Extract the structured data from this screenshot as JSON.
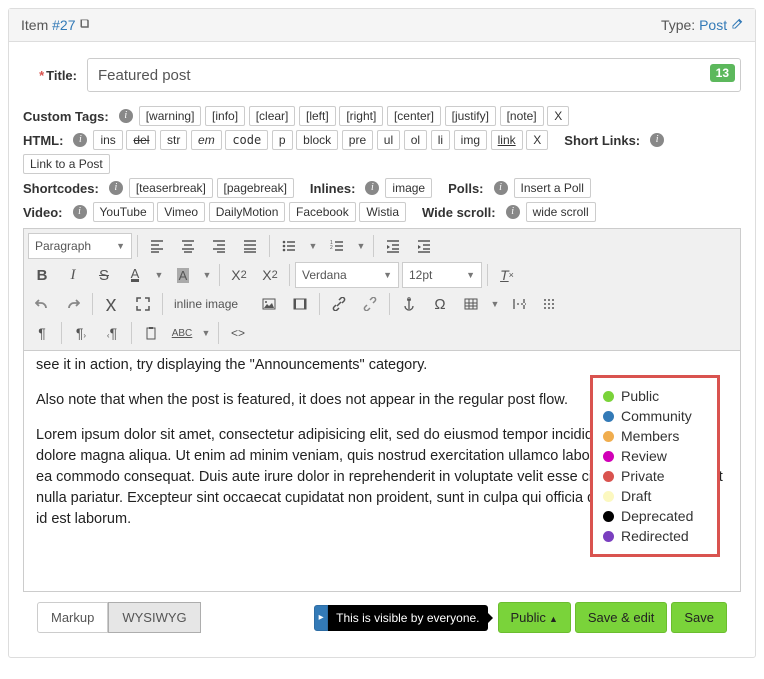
{
  "header": {
    "item_label": "Item",
    "item_link": "#27",
    "type_label": "Type:",
    "type_value": "Post"
  },
  "title": {
    "label": "Title:",
    "value": "Featured post",
    "badge": "13"
  },
  "toolrows": {
    "custom_tags_label": "Custom Tags:",
    "custom_tags": [
      "[warning]",
      "[info]",
      "[clear]",
      "[left]",
      "[right]",
      "[center]",
      "[justify]",
      "[note]",
      "X"
    ],
    "html_label": "HTML:",
    "html_btns": [
      "ins",
      "del",
      "str",
      "em",
      "code",
      "p",
      "block",
      "pre",
      "ul",
      "ol",
      "li",
      "img",
      "link",
      "X"
    ],
    "short_links_label": "Short Links:",
    "short_links_btn": "Link to a Post",
    "shortcodes_label": "Shortcodes:",
    "shortcodes_btns": [
      "[teaserbreak]",
      "[pagebreak]"
    ],
    "inlines_label": "Inlines:",
    "inlines_btn": "image",
    "polls_label": "Polls:",
    "polls_btn": "Insert a Poll",
    "video_label": "Video:",
    "video_btns": [
      "YouTube",
      "Vimeo",
      "DailyMotion",
      "Facebook",
      "Wistia"
    ],
    "wide_scroll_label": "Wide scroll:",
    "wide_scroll_btn": "wide scroll"
  },
  "editor": {
    "format_select": "Paragraph",
    "font_select": "Verdana",
    "size_select": "12pt",
    "inline_image": "inline image"
  },
  "content": {
    "p1": "see it in action, try displaying the \"Announcements\" category.",
    "p2": "Also note that when the post is featured, it does not appear in the regular post flow.",
    "p3": "Lorem ipsum dolor sit amet, consectetur adipisicing elit, sed do eiusmod tempor incididunt ut labore et dolore magna aliqua. Ut enim ad minim veniam, quis nostrud exercitation ullamco laboris nisi ut aliquip ex ea commodo consequat. Duis aute irure dolor in reprehenderit in voluptate velit esse cillum dolore eu fugiat nulla pariatur. Excepteur sint occaecat cupidatat non proident, sunt in culpa qui officia deserunt mollit anim id est laborum."
  },
  "statuses": [
    {
      "label": "Public",
      "color": "#7ad33a"
    },
    {
      "label": "Community",
      "color": "#337ab7"
    },
    {
      "label": "Members",
      "color": "#f0ad4e"
    },
    {
      "label": "Review",
      "color": "#d100b7"
    },
    {
      "label": "Private",
      "color": "#d9534f"
    },
    {
      "label": "Draft",
      "color": "#fcf8c0"
    },
    {
      "label": "Deprecated",
      "color": "#000000"
    },
    {
      "label": "Redirected",
      "color": "#7a3fbf"
    }
  ],
  "footer": {
    "markup": "Markup",
    "wysiwyg": "WYSIWYG",
    "tooltip": "This is visible by everyone.",
    "visibility_btn": "Public",
    "save_edit": "Save & edit",
    "save": "Save"
  }
}
